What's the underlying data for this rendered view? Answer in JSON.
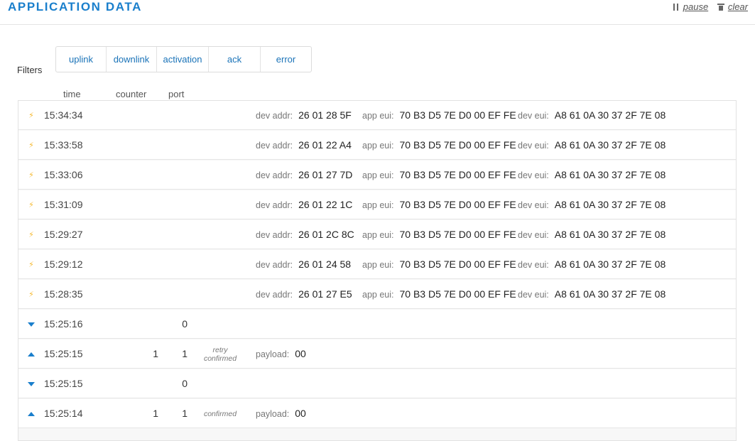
{
  "header": {
    "title": "APPLICATION DATA",
    "pause_label": "pause",
    "clear_label": "clear"
  },
  "filters": {
    "label": "Filters",
    "buttons": [
      "uplink",
      "downlink",
      "activation",
      "ack",
      "error"
    ]
  },
  "columns": {
    "time": "time",
    "counter": "counter",
    "port": "port"
  },
  "labels": {
    "dev_addr": "dev addr:",
    "app_eui": "app eui:",
    "dev_eui": "dev eui:",
    "payload": "payload:"
  },
  "colors": {
    "accent": "#1a7fcc",
    "activation": "#f5b82e",
    "link": "#1a73b8"
  },
  "rows": [
    {
      "type": "activation",
      "icon": "bolt-icon",
      "time": "15:34:34",
      "dev_addr": "26 01 28 5F",
      "app_eui": "70 B3 D5 7E D0 00 EF FE",
      "dev_eui": "A8 61 0A 30 37 2F 7E 08"
    },
    {
      "type": "activation",
      "icon": "bolt-icon",
      "time": "15:33:58",
      "dev_addr": "26 01 22 A4",
      "app_eui": "70 B3 D5 7E D0 00 EF FE",
      "dev_eui": "A8 61 0A 30 37 2F 7E 08"
    },
    {
      "type": "activation",
      "icon": "bolt-icon",
      "time": "15:33:06",
      "dev_addr": "26 01 27 7D",
      "app_eui": "70 B3 D5 7E D0 00 EF FE",
      "dev_eui": "A8 61 0A 30 37 2F 7E 08"
    },
    {
      "type": "activation",
      "icon": "bolt-icon",
      "time": "15:31:09",
      "dev_addr": "26 01 22 1C",
      "app_eui": "70 B3 D5 7E D0 00 EF FE",
      "dev_eui": "A8 61 0A 30 37 2F 7E 08"
    },
    {
      "type": "activation",
      "icon": "bolt-icon",
      "time": "15:29:27",
      "dev_addr": "26 01 2C 8C",
      "app_eui": "70 B3 D5 7E D0 00 EF FE",
      "dev_eui": "A8 61 0A 30 37 2F 7E 08"
    },
    {
      "type": "activation",
      "icon": "bolt-icon",
      "time": "15:29:12",
      "dev_addr": "26 01 24 58",
      "app_eui": "70 B3 D5 7E D0 00 EF FE",
      "dev_eui": "A8 61 0A 30 37 2F 7E 08"
    },
    {
      "type": "activation",
      "icon": "bolt-icon",
      "time": "15:28:35",
      "dev_addr": "26 01 27 E5",
      "app_eui": "70 B3 D5 7E D0 00 EF FE",
      "dev_eui": "A8 61 0A 30 37 2F 7E 08"
    },
    {
      "type": "downlink",
      "icon": "arrow-down-icon",
      "time": "15:25:16",
      "counter": "",
      "port": "0"
    },
    {
      "type": "uplink",
      "icon": "arrow-up-icon",
      "time": "15:25:15",
      "counter": "1",
      "port": "1",
      "flags": [
        "retry",
        "confirmed"
      ],
      "payload": "00"
    },
    {
      "type": "downlink",
      "icon": "arrow-down-icon",
      "time": "15:25:15",
      "counter": "",
      "port": "0"
    },
    {
      "type": "uplink",
      "icon": "arrow-up-icon",
      "time": "15:25:14",
      "counter": "1",
      "port": "1",
      "flags": [
        "confirmed"
      ],
      "payload": "00"
    }
  ]
}
